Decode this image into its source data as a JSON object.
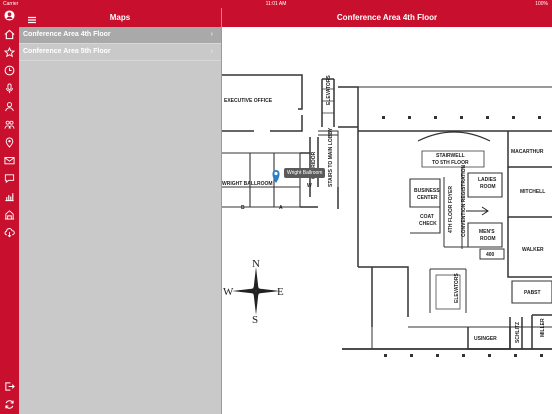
{
  "status": {
    "carrier": "Carrier",
    "time": "11:01 AM",
    "battery": "100%"
  },
  "sidebar_header": {
    "title": "Maps"
  },
  "sidebar_items": [
    {
      "label": "Conference Area 4th Floor",
      "selected": true
    },
    {
      "label": "Conference Area 5th Floor",
      "selected": false
    }
  ],
  "main_header": {
    "title": "Conference Area 4th Floor"
  },
  "rail_icons": [
    "person-icon",
    "home-icon",
    "star-icon",
    "clock-icon",
    "microphone-icon",
    "people-icon",
    "handshake-icon",
    "map-pin-icon",
    "envelope-icon",
    "chat-icon",
    "bar-chart-icon",
    "building-icon",
    "cloud-download-icon",
    "logout-icon",
    "refresh-icon"
  ],
  "map": {
    "pin_label": "Wright Ballroom",
    "compass": {
      "n": "N",
      "s": "S",
      "e": "E",
      "w": "W"
    },
    "rooms": {
      "executive_office": "EXECUTIVE OFFICE",
      "wright_ballroom": "WRIGHT BALLROOM",
      "section_b": "B",
      "section_a": "A",
      "elevators_top": "ELEVATORS",
      "corridor": "CORRIDOR",
      "corridor_w": "W",
      "stairs_to_lobby": "STAIRS TO MAIN LOBBY",
      "stairwell_line1": "STAIRWELL",
      "stairwell_line2": "TO 5TH FLOOR",
      "macarthur": "MACARTHUR",
      "mitchell": "MITCHELL",
      "ladies_line1": "LADIES",
      "ladies_line2": "ROOM",
      "mens_line1": "MEN'S",
      "mens_line2": "ROOM",
      "business_line1": "BUSINESS",
      "business_line2": "CENTER",
      "coat_line1": "COAT",
      "coat_line2": "CHECK",
      "foyer": "4TH FLOOR FOYER",
      "convention_registration": "CONVENTION REGISTRATION",
      "room_400": "400",
      "walker": "WALKER",
      "elevators_bottom": "ELEVATORS",
      "pabst": "PABST",
      "usinger": "USINGER",
      "schlitz": "SCHLITZ",
      "miller": "MILLER"
    }
  }
}
